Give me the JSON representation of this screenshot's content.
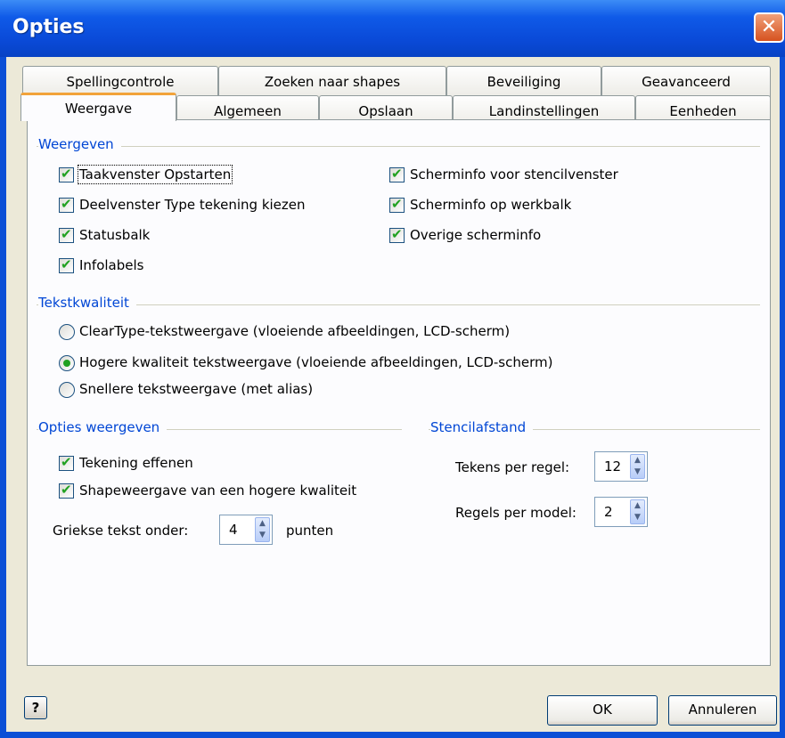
{
  "window": {
    "title": "Opties",
    "close": "✕"
  },
  "tabs_row1": [
    "Spellingcontrole",
    "Zoeken naar shapes",
    "Beveiliging",
    "Geavanceerd"
  ],
  "tabs_row2": [
    "Weergave",
    "Algemeen",
    "Opslaan",
    "Landinstellingen",
    "Eenheden"
  ],
  "weergeven": {
    "title": "Weergeven",
    "left": [
      {
        "label": "Taakvenster Opstarten",
        "checked": true
      },
      {
        "label": "Deelvenster Type tekening kiezen",
        "checked": true
      },
      {
        "label": "Statusbalk",
        "checked": true
      },
      {
        "label": "Infolabels",
        "checked": true
      }
    ],
    "right": [
      {
        "label": "Scherminfo voor stencilvenster",
        "checked": true
      },
      {
        "label": "Scherminfo op werkbalk",
        "checked": true
      },
      {
        "label": "Overige scherminfo",
        "checked": true
      }
    ]
  },
  "tekstkwaliteit": {
    "title": "Tekstkwaliteit",
    "options": [
      {
        "label": "ClearType-tekstweergave (vloeiende afbeeldingen, LCD-scherm)",
        "selected": false
      },
      {
        "label": "Hogere kwaliteit tekstweergave (vloeiende afbeeldingen, LCD-scherm)",
        "selected": true
      },
      {
        "label": "Snellere tekstweergave (met alias)",
        "selected": false
      }
    ]
  },
  "opties_weergeven": {
    "title": "Opties weergeven",
    "checks": [
      {
        "label": "Tekening effenen",
        "checked": true
      },
      {
        "label": "Shapeweergave van een hogere kwaliteit",
        "checked": true
      }
    ],
    "griekse_label": "Griekse tekst onder:",
    "griekse_value": "4",
    "griekse_unit": "punten"
  },
  "stencilafstand": {
    "title": "Stencilafstand",
    "tekens_label": "Tekens per regel:",
    "tekens_value": "12",
    "regels_label": "Regels per model:",
    "regels_value": "2"
  },
  "buttons": {
    "help": "?",
    "ok": "OK",
    "cancel": "Annuleren"
  },
  "icons": {
    "close": "close-icon",
    "help": "help-icon",
    "spin": "spin-arrows-icon"
  },
  "colors": {
    "titlebar": "#0a4ad8",
    "group_title": "#0046d5",
    "active_tab_accent": "#f2a33a",
    "check": "#21a121"
  }
}
